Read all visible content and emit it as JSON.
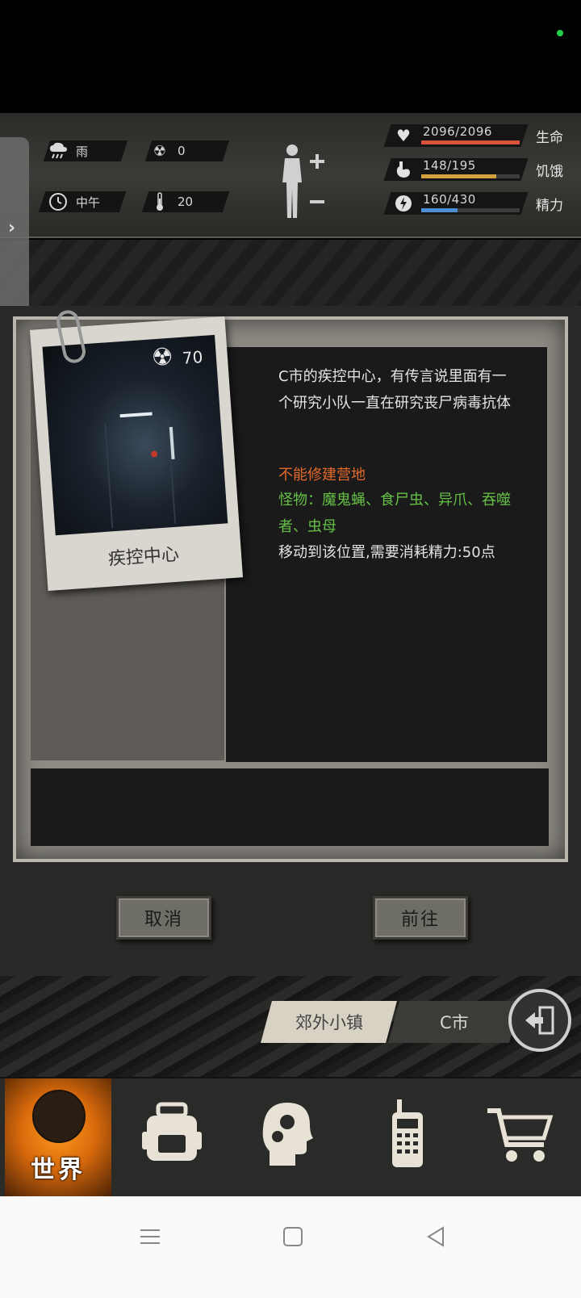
{
  "weather": {
    "condition": "雨",
    "radiation": "0",
    "time_of_day": "中午",
    "temperature": "20"
  },
  "stats": [
    {
      "value": "2096/2096",
      "label": "生命",
      "fill_fraction": 1.0,
      "color": "#d9543d"
    },
    {
      "value": "148/195",
      "label": "饥饿",
      "fill_fraction": 0.76,
      "color": "#d4a23c"
    },
    {
      "value": "160/430",
      "label": "精力",
      "fill_fraction": 0.37,
      "color": "#4a8fd4"
    }
  ],
  "location": {
    "name": "疾控中心",
    "radiation": "70",
    "description": "C市的疾控中心，有传言说里面有一个研究小队一直在研究丧尸病毒抗体",
    "camp_note": "不能修建营地",
    "monsters": "怪物：魔鬼蝇、食尸虫、异爪、吞噬者、虫母",
    "move_cost": "移动到该位置,需要消耗精力:50点"
  },
  "buttons": {
    "cancel": "取消",
    "go": "前往"
  },
  "map_tabs": {
    "suburb": "郊外小镇",
    "city": "C市"
  },
  "nav": {
    "world": "世界"
  },
  "colors": {
    "accent_orange": "#e26a2c",
    "monster_green": "#66c046"
  }
}
